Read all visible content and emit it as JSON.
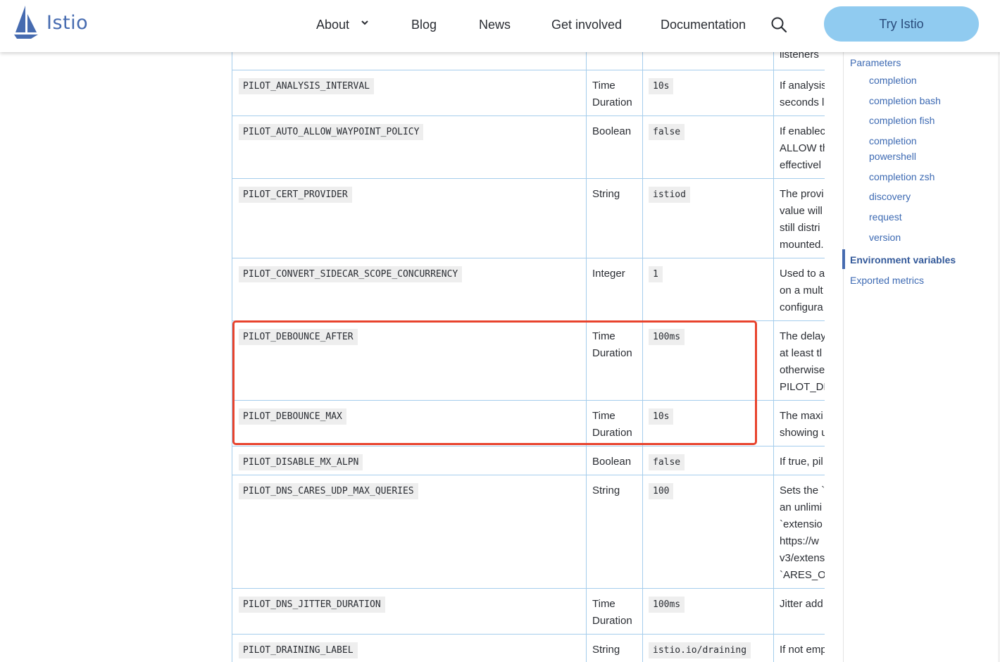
{
  "header": {
    "brand": "Istio",
    "nav": [
      "About",
      "Blog",
      "News",
      "Get involved",
      "Documentation"
    ],
    "cta": "Try Istio"
  },
  "toc": {
    "items": [
      {
        "label": "Parameters",
        "level": 1
      },
      {
        "label": "completion",
        "level": 2
      },
      {
        "label": "completion bash",
        "level": 2
      },
      {
        "label": "completion fish",
        "level": 2
      },
      {
        "label": "completion",
        "level": 2
      },
      {
        "label": "powershell",
        "level": 2
      },
      {
        "label": "completion zsh",
        "level": 2
      },
      {
        "label": "discovery",
        "level": 2
      },
      {
        "label": "request",
        "level": 2
      },
      {
        "label": "version",
        "level": 2
      },
      {
        "label": "Environment variables",
        "level": 1,
        "active": true
      },
      {
        "label": "Exported metrics",
        "level": 1
      }
    ]
  },
  "table": {
    "partial_top_desc": "listeners",
    "rows": [
      {
        "name": "PILOT_ANALYSIS_INTERVAL",
        "type": [
          "Time",
          "Duration"
        ],
        "default": "10s",
        "desc": [
          "If analysis",
          "seconds l"
        ]
      },
      {
        "name": "PILOT_AUTO_ALLOW_WAYPOINT_POLICY",
        "type": [
          "Boolean"
        ],
        "default": "false",
        "desc": [
          "If enablec",
          "ALLOW th",
          "effectivel"
        ]
      },
      {
        "name": "PILOT_CERT_PROVIDER",
        "type": [
          "String"
        ],
        "default": "istiod",
        "desc": [
          "The provi",
          "value will",
          "still distri",
          "mounted."
        ]
      },
      {
        "name": "PILOT_CONVERT_SIDECAR_SCOPE_CONCURRENCY",
        "type": [
          "Integer"
        ],
        "default": "1",
        "desc": [
          "Used to a",
          "on a mult",
          "configura"
        ]
      },
      {
        "name": "PILOT_DEBOUNCE_AFTER",
        "type": [
          "Time",
          "Duration"
        ],
        "default": "100ms",
        "desc": [
          "The delay",
          "at least tl",
          "otherwise",
          "PILOT_DE"
        ]
      },
      {
        "name": "PILOT_DEBOUNCE_MAX",
        "type": [
          "Time",
          "Duration"
        ],
        "default": "10s",
        "desc": [
          "The maxi",
          "showing u"
        ]
      },
      {
        "name": "PILOT_DISABLE_MX_ALPN",
        "type": [
          "Boolean"
        ],
        "default": "false",
        "desc": [
          "If true, pil"
        ]
      },
      {
        "name": "PILOT_DNS_CARES_UDP_MAX_QUERIES",
        "type": [
          "String"
        ],
        "default": "100",
        "desc": [
          "Sets the `",
          "an unlimi",
          "`extensio",
          "https://w",
          "v3/extens",
          "`ARES_OF"
        ]
      },
      {
        "name": "PILOT_DNS_JITTER_DURATION",
        "type": [
          "Time",
          "Duration"
        ],
        "default": "100ms",
        "desc": [
          "Jitter add"
        ]
      },
      {
        "name": "PILOT_DRAINING_LABEL",
        "type": [
          "String"
        ],
        "default": "istio.io/draining",
        "desc": [
          "If not emp"
        ]
      }
    ]
  }
}
